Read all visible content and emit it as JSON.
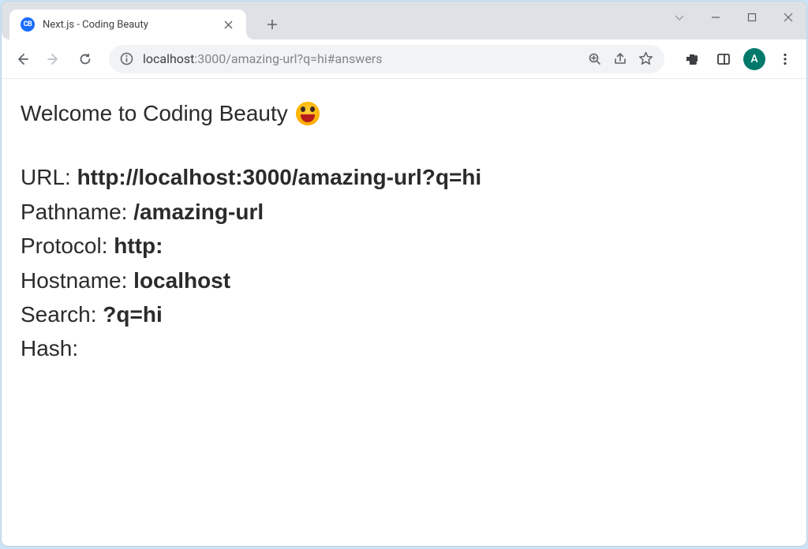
{
  "window": {
    "favicon_text": "CB",
    "tab_title": "Next.js - Coding Beauty",
    "avatar_letter": "A"
  },
  "address_bar": {
    "host": "localhost",
    "port_path": ":3000/amazing-url?q=hi#answers"
  },
  "page": {
    "heading": "Welcome to Coding Beauty",
    "rows": {
      "url": {
        "label": "URL: ",
        "value": "http://localhost:3000/amazing-url?q=hi"
      },
      "pathname": {
        "label": "Pathname: ",
        "value": "/amazing-url"
      },
      "protocol": {
        "label": "Protocol: ",
        "value": "http:"
      },
      "hostname": {
        "label": "Hostname: ",
        "value": "localhost"
      },
      "search": {
        "label": "Search: ",
        "value": "?q=hi"
      },
      "hash": {
        "label": "Hash:",
        "value": ""
      }
    }
  }
}
